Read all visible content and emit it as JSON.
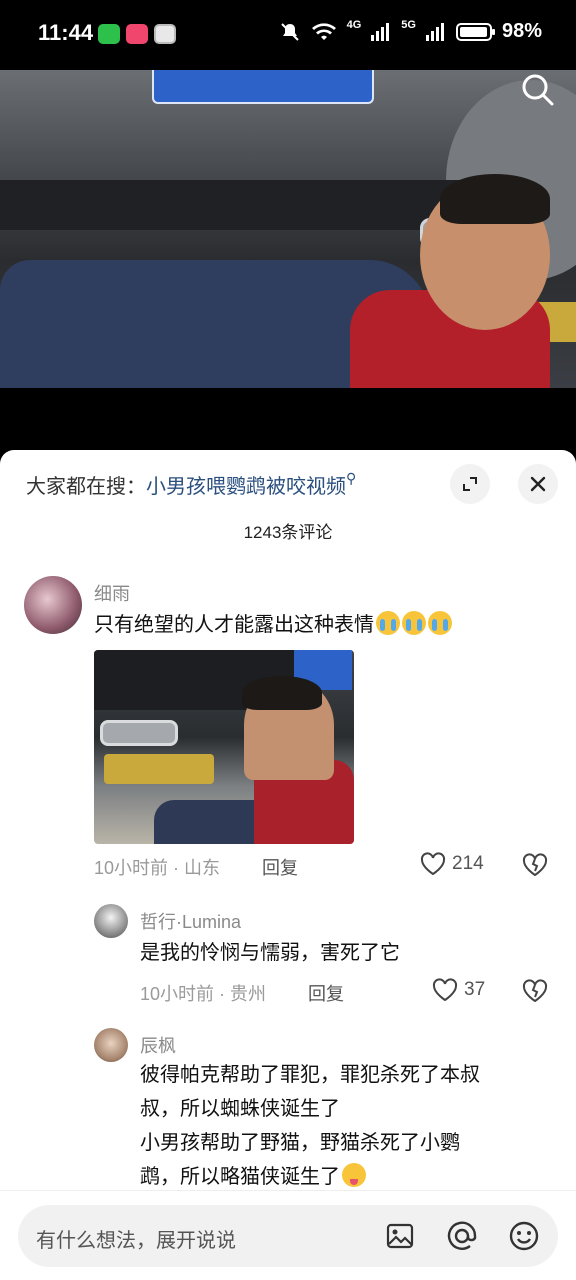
{
  "status_bar": {
    "time": "11:44",
    "network_4g": "4G",
    "network_5g": "5G",
    "battery_text": "98%",
    "battery_level": 0.98
  },
  "video": {
    "search_icon": "search-icon"
  },
  "trending": {
    "label": "大家都在搜：",
    "query": "小男孩喂鹦鹉被咬视频"
  },
  "comment_count": "1243条评论",
  "comments": [
    {
      "user": "细雨",
      "text": "只有绝望的人才能露出这种表情",
      "time_location": "10小时前 · 山东",
      "reply_label": "回复",
      "likes": "214"
    },
    {
      "user": "哲行·Lumina",
      "text": "是我的怜悯与懦弱，害死了它",
      "time_location": "10小时前 · 贵州",
      "reply_label": "回复",
      "likes": "37"
    },
    {
      "user": "辰枫",
      "text_lines": [
        "彼得帕克帮助了罪犯，罪犯杀死了本叔",
        "叔，所以蜘蛛侠诞生了",
        "小男孩帮助了野猫，野猫杀死了小鹦",
        "鹉，所以略猫侠诞生了"
      ]
    }
  ],
  "input_bar": {
    "placeholder": "有什么想法，展开说说"
  }
}
